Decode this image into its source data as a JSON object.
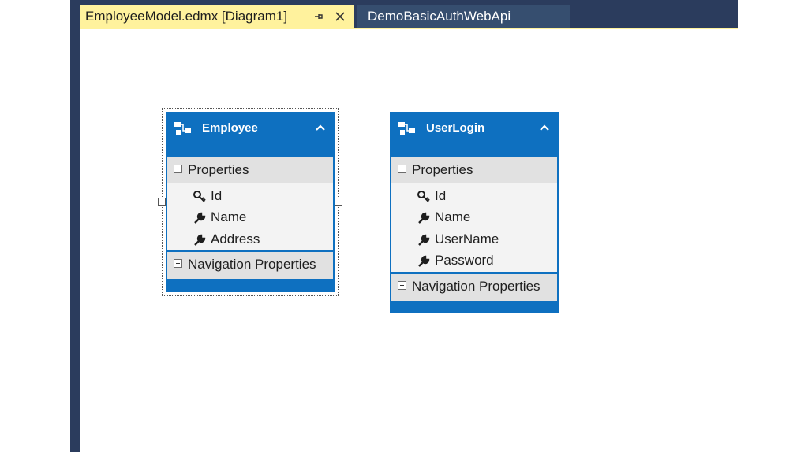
{
  "tabs": {
    "active_label": "EmployeeModel.edmx [Diagram1]",
    "inactive_label": "DemoBasicAuthWebApi"
  },
  "icons": {
    "pin": "pin-icon",
    "close": "close-icon",
    "entity": "entity-icon",
    "collapse": "chevron-up-icon",
    "key": "key-icon",
    "property": "wrench-icon"
  },
  "colors": {
    "entity_blue": "#0e70c0",
    "tab_active_bg": "#fff29d",
    "ide_frame": "#2b3c5d"
  },
  "entities": [
    {
      "title": "Employee",
      "properties_label": "Properties",
      "properties": [
        "Id",
        "Name",
        "Address"
      ],
      "navigation_label": "Navigation Properties"
    },
    {
      "title": "UserLogin",
      "properties_label": "Properties",
      "properties": [
        "Id",
        "Name",
        "UserName",
        "Password"
      ],
      "navigation_label": "Navigation Properties"
    }
  ]
}
